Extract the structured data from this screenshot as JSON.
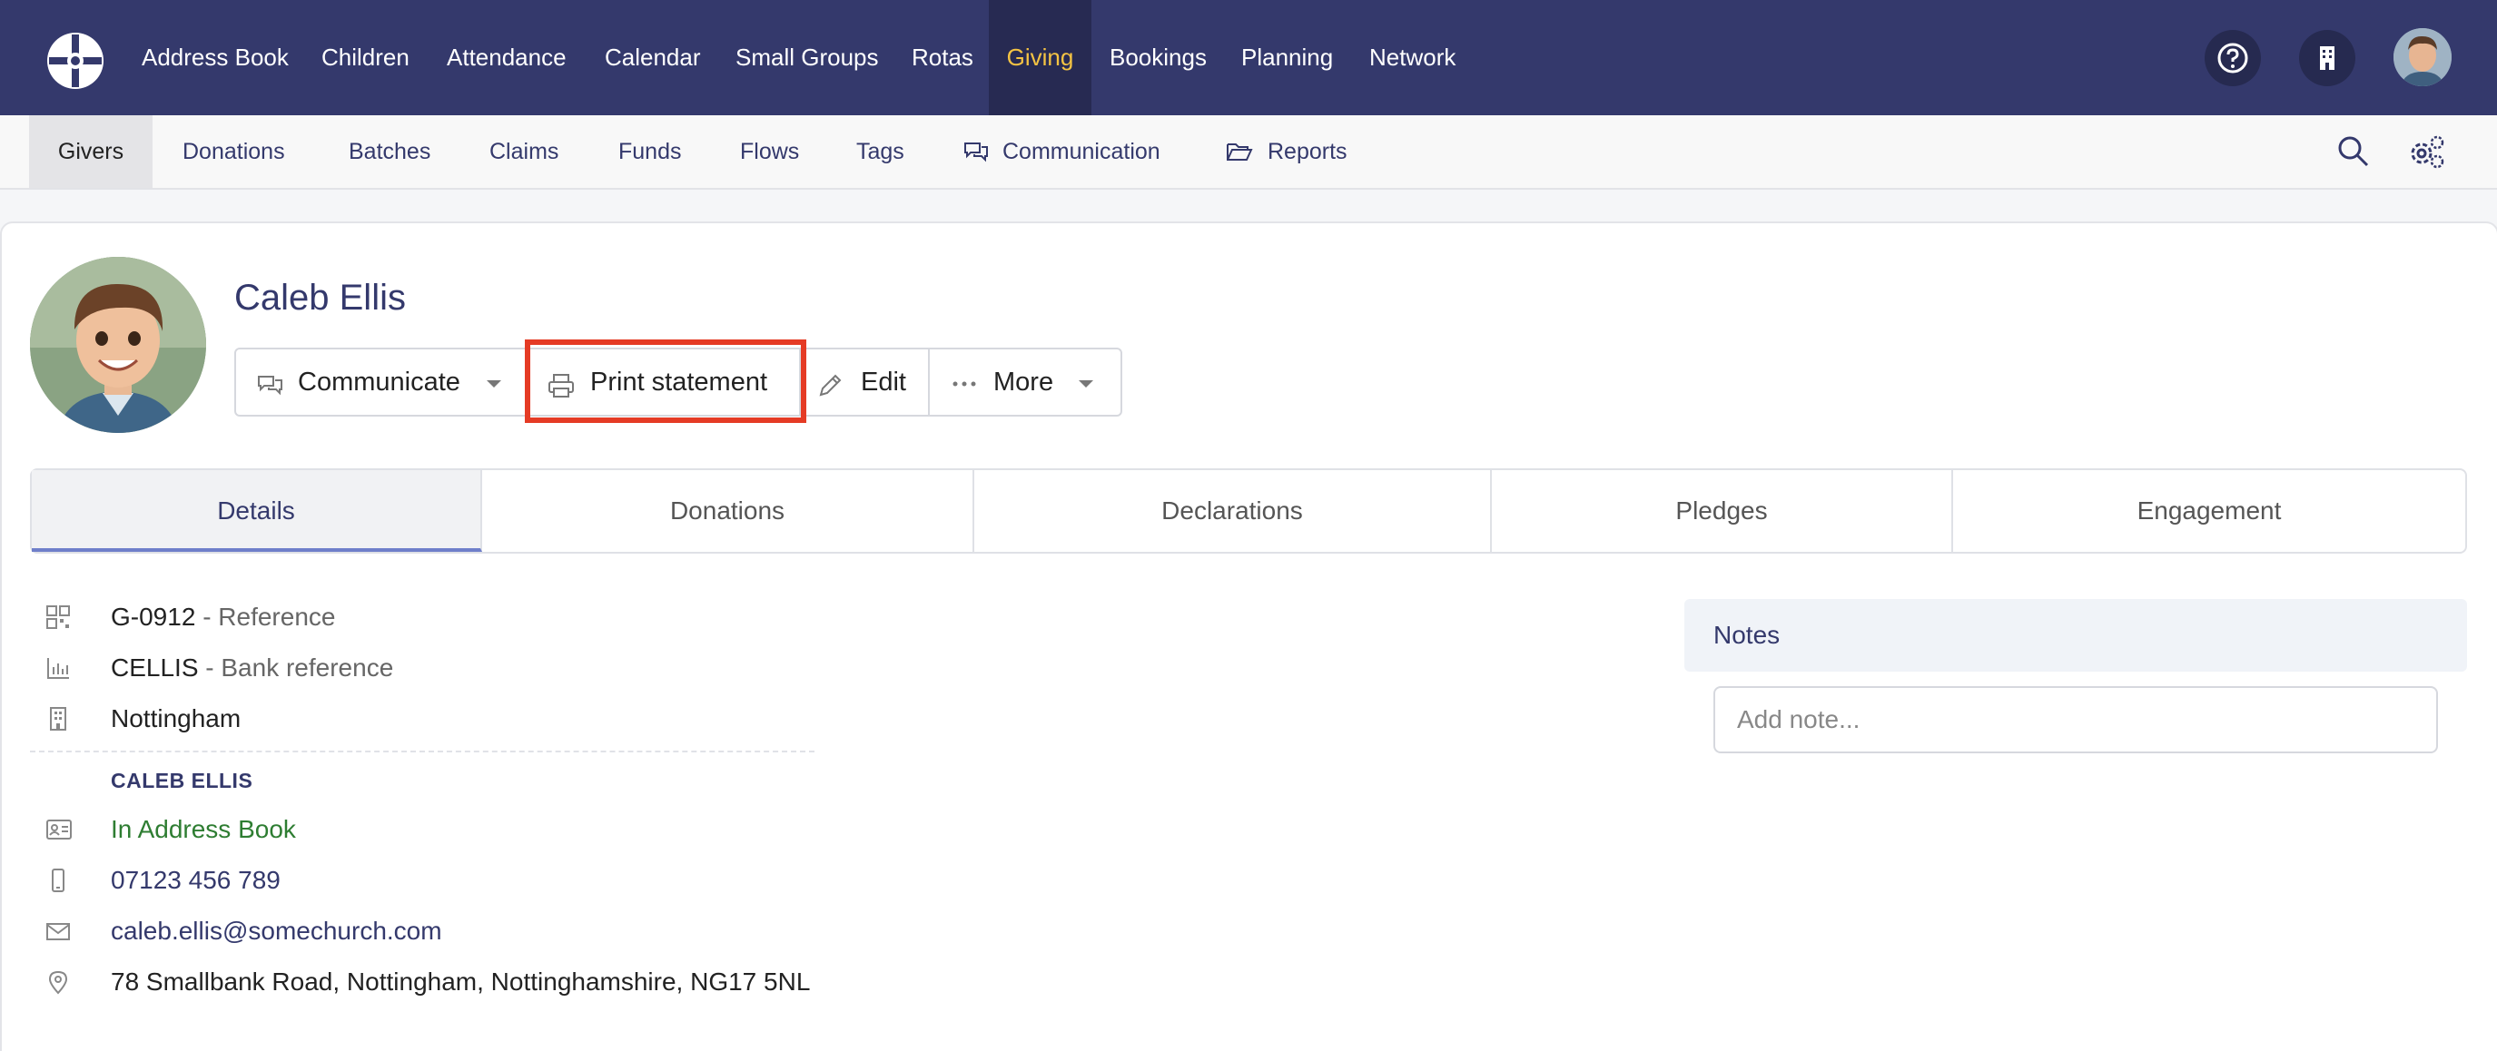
{
  "topnav": {
    "items": [
      "Address Book",
      "Children",
      "Attendance",
      "Calendar",
      "Small Groups",
      "Rotas",
      "Giving",
      "Bookings",
      "Planning",
      "Network"
    ],
    "active": "Giving",
    "icons": [
      "help-icon",
      "organisation-icon",
      "user-avatar"
    ],
    "colors": {
      "background": "#34396c",
      "active_background": "#272a52",
      "active_text": "#f4c343"
    }
  },
  "subnav": {
    "items": [
      "Givers",
      "Donations",
      "Batches",
      "Claims",
      "Funds",
      "Flows",
      "Tags",
      "Communication",
      "Reports"
    ],
    "active": "Givers",
    "right_icons": [
      "search-icon",
      "settings-icon"
    ]
  },
  "profile": {
    "name": "Caleb Ellis",
    "buttons": {
      "communicate": "Communicate",
      "print_statement": "Print statement",
      "edit": "Edit",
      "more": "More"
    },
    "highlighted_button": "Print statement"
  },
  "tabs": {
    "items": [
      "Details",
      "Donations",
      "Declarations",
      "Pledges",
      "Engagement"
    ],
    "active": "Details"
  },
  "details": {
    "reference": {
      "value": "G-0912",
      "label": "- Reference"
    },
    "bank_reference": {
      "value": "CELLIS",
      "label": "- Bank reference"
    },
    "location": "Nottingham",
    "contact_section": "CALEB ELLIS",
    "address_book_status": "In Address Book",
    "phone": "07123 456 789",
    "email": "caleb.ellis@somechurch.com",
    "address": "78 Smallbank Road, Nottingham, Nottinghamshire, NG17 5NL"
  },
  "notes": {
    "title": "Notes",
    "placeholder": "Add note...",
    "value": ""
  }
}
